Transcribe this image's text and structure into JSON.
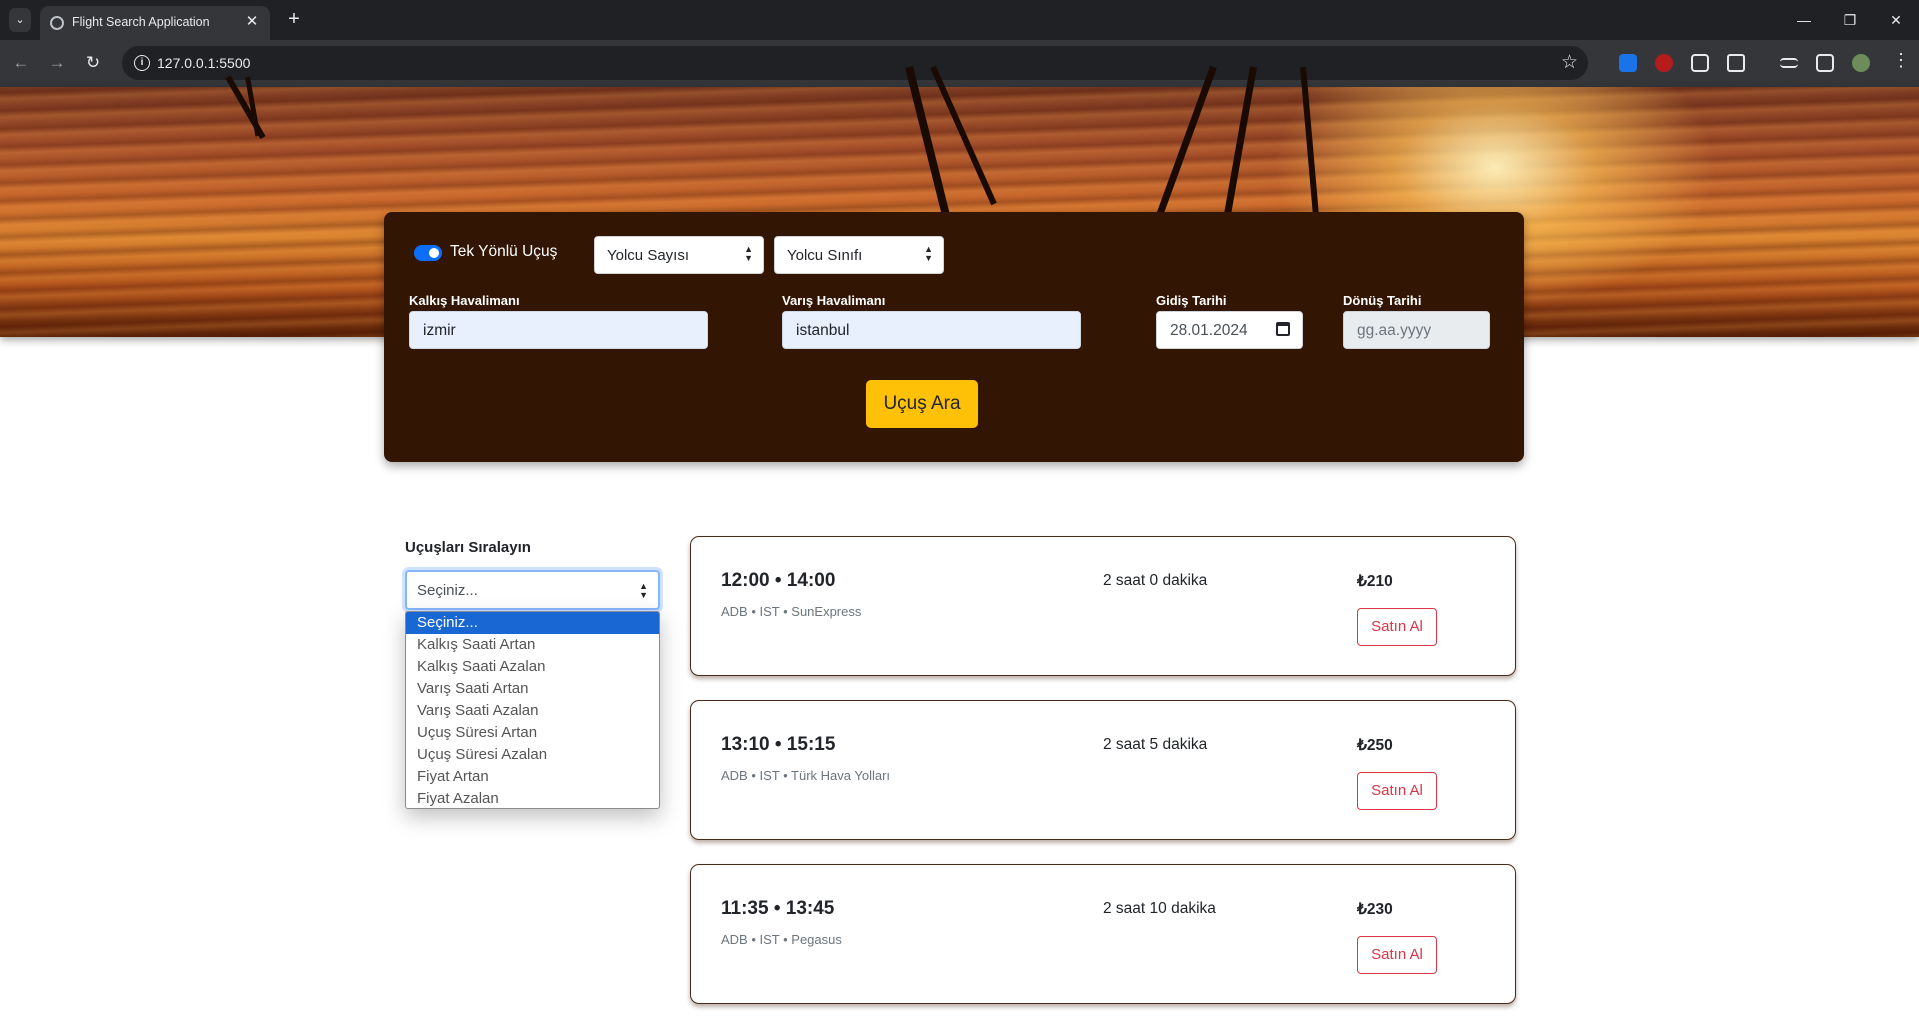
{
  "browser": {
    "tab_title": "Flight Search Application",
    "url": "127.0.0.1:5500"
  },
  "search": {
    "one_way_label": "Tek Yönlü Uçuş",
    "one_way_enabled": true,
    "passenger_count_placeholder": "Yolcu Sayısı",
    "passenger_class_placeholder": "Yolcu Sınıfı",
    "departure_airport_label": "Kalkış Havalimanı",
    "departure_airport_value": "izmir",
    "arrival_airport_label": "Varış Havalimanı",
    "arrival_airport_value": "istanbul",
    "departure_date_label": "Gidiş Tarihi",
    "departure_date_value": "28.01.2024",
    "return_date_label": "Dönüş Tarihi",
    "return_date_placeholder": "gg.aa.yyyy",
    "search_button": "Uçuş Ara"
  },
  "sort": {
    "label": "Uçuşları Sıralayın",
    "selected": "Seçiniz...",
    "options": [
      "Seçiniz...",
      "Kalkış Saati Artan",
      "Kalkış Saati Azalan",
      "Varış Saati Artan",
      "Varış Saati Azalan",
      "Uçuş Süresi Artan",
      "Uçuş Süresi Azalan",
      "Fiyat Artan",
      "Fiyat Azalan"
    ]
  },
  "flights": [
    {
      "times": "12:00 • 14:00",
      "route": "ADB • IST • SunExpress",
      "duration": "2 saat 0 dakika",
      "price": "₺210",
      "buy_label": "Satın Al"
    },
    {
      "times": "13:10 • 15:15",
      "route": "ADB • IST • Türk Hava Yolları",
      "duration": "2 saat 5 dakika",
      "price": "₺250",
      "buy_label": "Satın Al"
    },
    {
      "times": "11:35 • 13:45",
      "route": "ADB • IST • Pegasus",
      "duration": "2 saat 10 dakika",
      "price": "₺230",
      "buy_label": "Satın Al"
    }
  ],
  "colors": {
    "search_card_bg": "#321503",
    "accent_button": "#ffc107",
    "buy_button": "#dc3545",
    "toggle_on": "#0d6efd"
  }
}
